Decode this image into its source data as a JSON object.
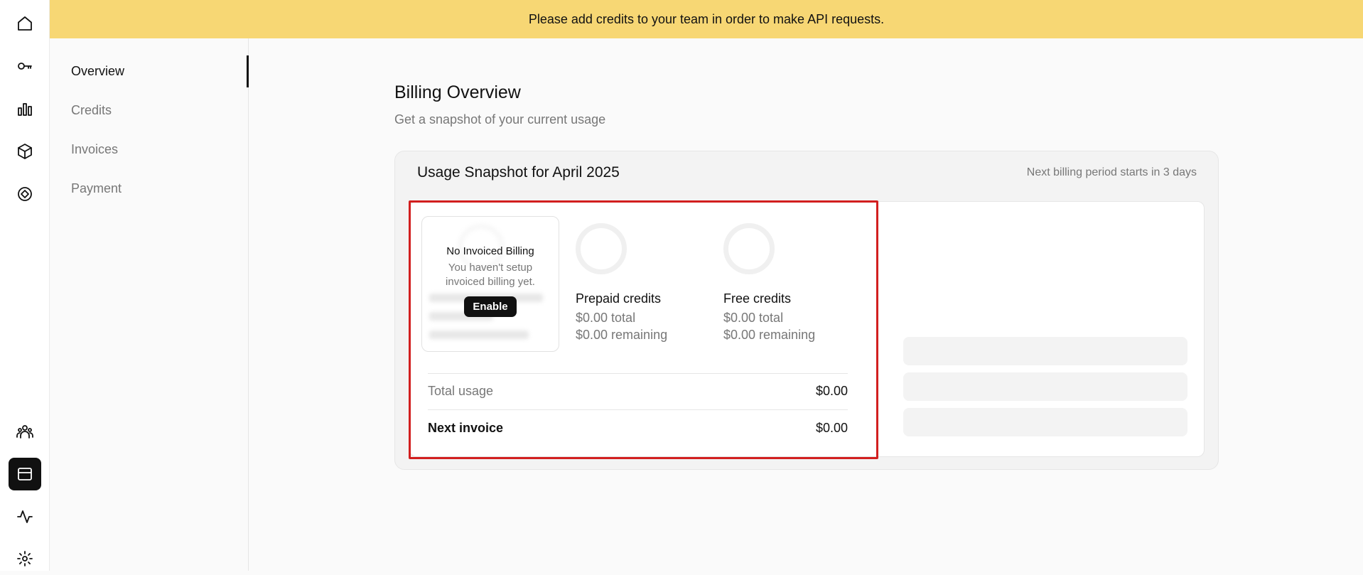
{
  "banner": {
    "text": "Please add credits to your team in order to make API requests."
  },
  "rail": {
    "items": [
      {
        "icon": "home-icon"
      },
      {
        "icon": "key-icon"
      },
      {
        "icon": "bar-chart-icon"
      },
      {
        "icon": "cube-icon"
      },
      {
        "icon": "diamond-arrow-icon"
      },
      {
        "icon": "team-icon"
      },
      {
        "icon": "billing-icon",
        "active": true
      },
      {
        "icon": "activity-icon"
      },
      {
        "icon": "gear-icon"
      }
    ]
  },
  "subnav": {
    "items": [
      {
        "label": "Overview",
        "active": true
      },
      {
        "label": "Credits"
      },
      {
        "label": "Invoices"
      },
      {
        "label": "Payment"
      }
    ]
  },
  "page": {
    "title": "Billing Overview",
    "subtitle": "Get a snapshot of your current usage"
  },
  "snapshot": {
    "title": "Usage Snapshot for April 2025",
    "period_note": "Next billing period starts in 3 days",
    "invoiced": {
      "title": "No Invoiced Billing",
      "text": "You haven't setup invoiced billing yet.",
      "button": "Enable"
    },
    "prepaid": {
      "name": "Prepaid credits",
      "total": "$0.00 total",
      "remaining": "$0.00 remaining"
    },
    "free": {
      "name": "Free credits",
      "total": "$0.00 total",
      "remaining": "$0.00 remaining"
    },
    "total_usage": {
      "label": "Total usage",
      "amount": "$0.00"
    },
    "next_invoice": {
      "label": "Next invoice",
      "amount": "$0.00"
    }
  },
  "colors": {
    "banner": "#f7d774",
    "highlight": "#d21f1f",
    "accent": "#111111"
  }
}
